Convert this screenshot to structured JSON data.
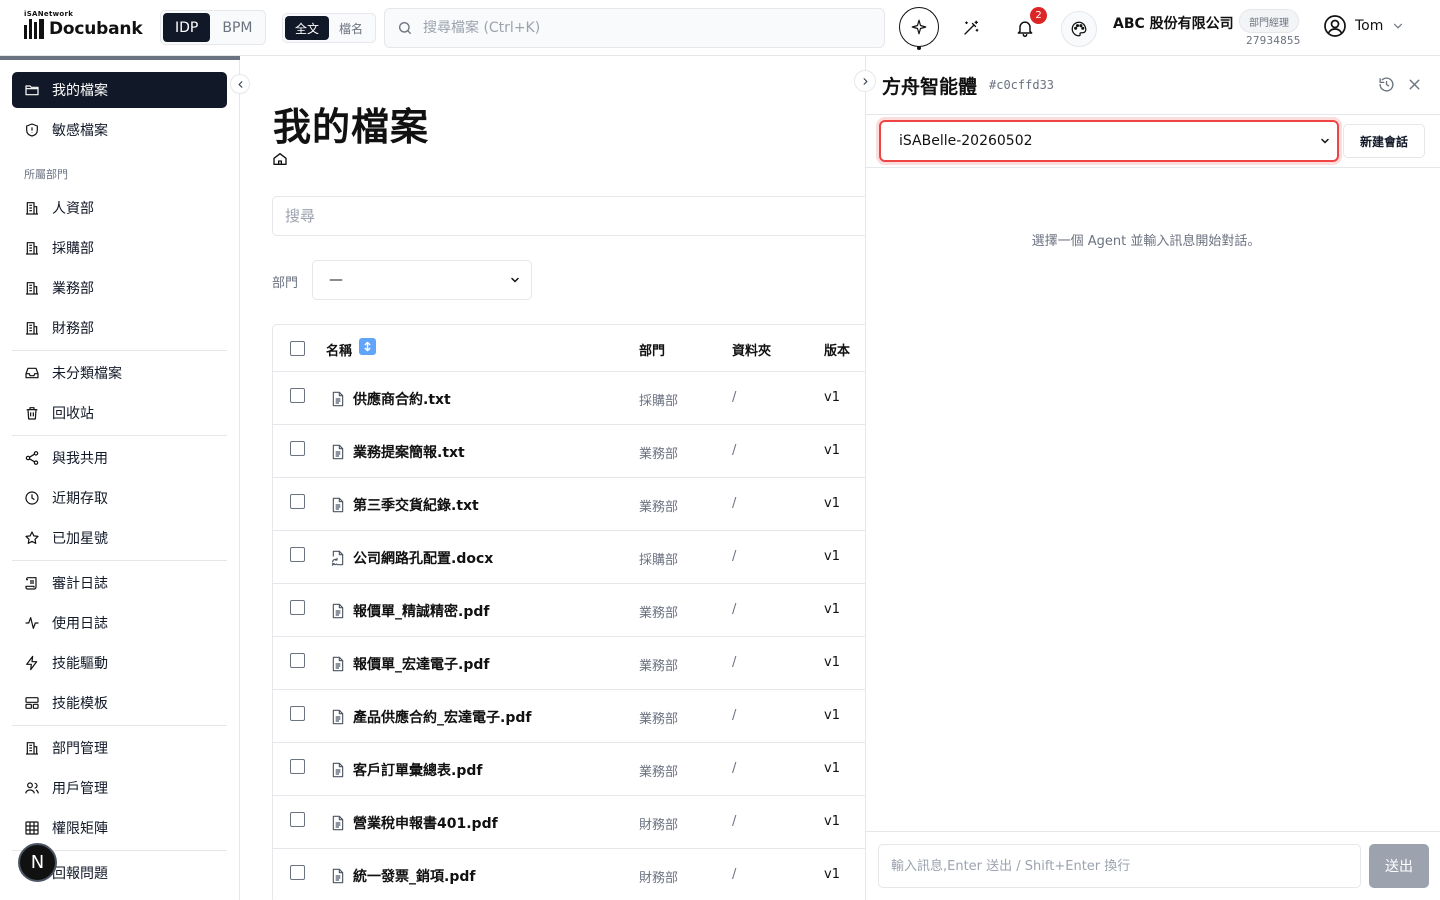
{
  "topbar": {
    "logo_network": "iSANetwork",
    "logo_name": "Docubank",
    "modes": [
      "IDP",
      "BPM"
    ],
    "search_scopes": [
      "全文",
      "檔名"
    ],
    "search_placeholder": "搜尋檔案 (Ctrl+K)",
    "notification_count": "2",
    "company_name": "ABC 股份有限公司",
    "role": "部門經理",
    "company_id": "27934855",
    "user_name": "Tom"
  },
  "sidebar": {
    "primary": [
      {
        "label": "我的檔案",
        "icon": "folder-icon",
        "active": true
      },
      {
        "label": "敏感檔案",
        "icon": "shield-icon"
      }
    ],
    "section_label": "所屬部門",
    "departments": [
      {
        "label": "人資部",
        "icon": "building-icon"
      },
      {
        "label": "採購部",
        "icon": "building-icon"
      },
      {
        "label": "業務部",
        "icon": "building-icon"
      },
      {
        "label": "財務部",
        "icon": "building-icon"
      }
    ],
    "group2": [
      {
        "label": "未分類檔案",
        "icon": "inbox-icon"
      },
      {
        "label": "回收站",
        "icon": "trash-icon"
      }
    ],
    "group3": [
      {
        "label": "與我共用",
        "icon": "share-icon"
      },
      {
        "label": "近期存取",
        "icon": "clock-icon"
      },
      {
        "label": "已加星號",
        "icon": "star-icon"
      }
    ],
    "group4": [
      {
        "label": "審計日誌",
        "icon": "scroll-icon"
      },
      {
        "label": "使用日誌",
        "icon": "activity-icon"
      },
      {
        "label": "技能驅動",
        "icon": "zap-icon"
      },
      {
        "label": "技能模板",
        "icon": "template-icon"
      }
    ],
    "group5": [
      {
        "label": "部門管理",
        "icon": "building-icon"
      },
      {
        "label": "用戶管理",
        "icon": "users-icon"
      },
      {
        "label": "權限矩陣",
        "icon": "grid-icon"
      }
    ],
    "group6": [
      {
        "label": "回報問題",
        "icon": "bug-icon"
      }
    ],
    "avatar_letter": "N"
  },
  "main": {
    "title": "我的檔案",
    "search_placeholder": "搜尋",
    "dept_label": "部門",
    "dept_selected": "—",
    "table": {
      "columns": [
        "名稱",
        "部門",
        "資料夾",
        "版本"
      ],
      "rows": [
        {
          "name": "供應商合約.txt",
          "dept": "採購部",
          "folder": "/",
          "version": "v1",
          "icon": "file-text-icon"
        },
        {
          "name": "業務提案簡報.txt",
          "dept": "業務部",
          "folder": "/",
          "version": "v1",
          "icon": "file-text-icon"
        },
        {
          "name": "第三季交貨紀錄.txt",
          "dept": "業務部",
          "folder": "/",
          "version": "v1",
          "icon": "file-text-icon"
        },
        {
          "name": "公司網路孔配置.docx",
          "dept": "採購部",
          "folder": "/",
          "version": "v1",
          "icon": "file-sync-icon"
        },
        {
          "name": "報價單_精誠精密.pdf",
          "dept": "業務部",
          "folder": "/",
          "version": "v1",
          "icon": "file-text-icon"
        },
        {
          "name": "報價單_宏達電子.pdf",
          "dept": "業務部",
          "folder": "/",
          "version": "v1",
          "icon": "file-text-icon"
        },
        {
          "name": "產品供應合約_宏達電子.pdf",
          "dept": "業務部",
          "folder": "/",
          "version": "v1",
          "icon": "file-text-icon"
        },
        {
          "name": "客戶訂單彙總表.pdf",
          "dept": "業務部",
          "folder": "/",
          "version": "v1",
          "icon": "file-text-icon"
        },
        {
          "name": "營業稅申報書401.pdf",
          "dept": "財務部",
          "folder": "/",
          "version": "v1",
          "icon": "file-text-icon"
        },
        {
          "name": "統一發票_銷項.pdf",
          "dept": "財務部",
          "folder": "/",
          "version": "v1",
          "icon": "file-text-icon"
        }
      ]
    }
  },
  "panel": {
    "title": "方舟智能體",
    "hash": "#c0cffd33",
    "agent_selected": "iSABelle-20260502",
    "new_chat_label": "新建會話",
    "empty_message": "選擇一個 Agent 並輸入訊息開始對話。",
    "input_placeholder": "輸入訊息,Enter 送出 / Shift+Enter 換行",
    "send_label": "送出"
  },
  "colors": {
    "primary_dark": "#111827",
    "badge_red": "#dc2626",
    "focus_red": "#ef4444",
    "sort_blue": "#60a5fa",
    "muted_text": "#6b7280"
  }
}
